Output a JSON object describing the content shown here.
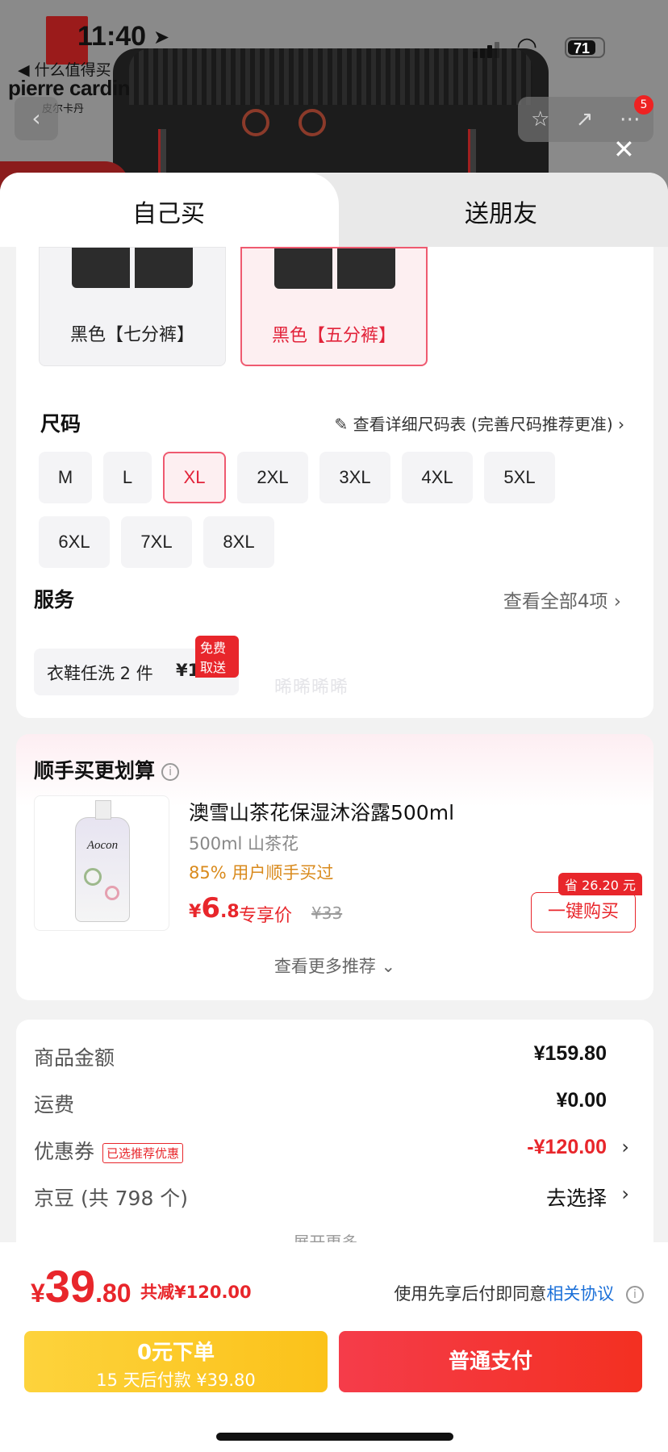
{
  "status": {
    "time": "11:40",
    "back_label": "◀ 什么值得买",
    "battery": "71"
  },
  "background": {
    "brand": "pierre cardin",
    "brand_cn": "皮尔卡丹",
    "cart_badge": "5"
  },
  "tabs": [
    {
      "label": "自己买",
      "active": true
    },
    {
      "label": "送朋友",
      "active": false
    }
  ],
  "colors": [
    {
      "label": "黑色【七分裤】",
      "selected": false
    },
    {
      "label": "黑色【五分裤】",
      "selected": true
    }
  ],
  "size": {
    "title": "尺码",
    "chart_link": "查看详细尺码表 (完善尺码推荐更准)",
    "options": [
      "M",
      "L",
      "XL",
      "2XL",
      "3XL",
      "4XL",
      "5XL",
      "6XL",
      "7XL",
      "8XL"
    ],
    "selected": "XL"
  },
  "service": {
    "title": "服务",
    "view_all": "查看全部4项",
    "item_name": "衣鞋任洗 2 件",
    "item_price": "¥118",
    "item_badge": "免费取送",
    "watermark": "晞晞晞晞"
  },
  "recommend": {
    "title": "顺手买更划算",
    "product_name": "澳雪山茶花保湿沐浴露500ml",
    "product_spec": "500ml 山茶花",
    "product_rate": "85% 用户顺手买过",
    "price_symbol": "¥",
    "price_int": "6",
    "price_dec": ".8",
    "price_label": "专享价",
    "orig_price": "¥33",
    "save_badge": "省 26.20 元",
    "buy_button": "一键购买",
    "bottle_label": "Aocon",
    "more": "查看更多推荐 ⌄"
  },
  "summary": {
    "rows": [
      {
        "label": "商品金额",
        "value": "¥159.80"
      },
      {
        "label": "运费",
        "value": "¥0.00"
      },
      {
        "label": "优惠券",
        "tag": "已选推荐优惠",
        "value": "-¥120.00"
      },
      {
        "label": "京豆 (共 798 个)",
        "value": "去选择"
      }
    ],
    "expand": "展开更多 ⌄"
  },
  "footer": {
    "total_symbol": "¥",
    "total_int": "39",
    "total_dec": ".80",
    "total_off": "共减¥120.00",
    "agree_text": "使用先享后付即同意",
    "agree_link": "相关协议",
    "later_title": "0元下单",
    "later_sub": "15 天后付款 ¥39.80",
    "pay_label": "普通支付"
  },
  "colors_theme": {
    "accent": "#e8262b",
    "link": "#1a6fd8",
    "yellow": "#fcc826"
  }
}
